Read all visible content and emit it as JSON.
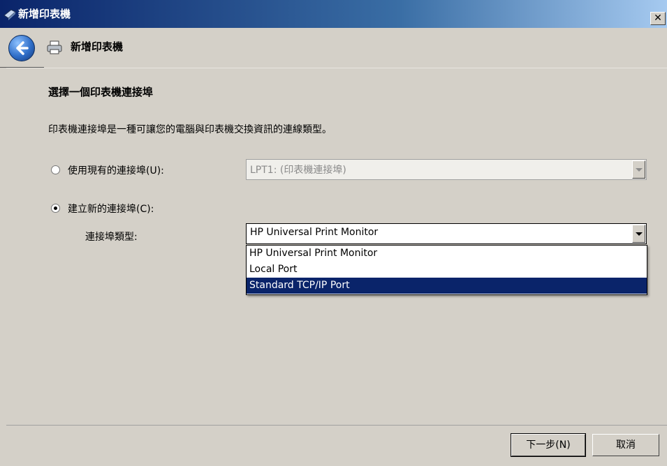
{
  "window": {
    "title": "新增印表機",
    "close_glyph": "✕"
  },
  "nav": {
    "title": "新增印表機",
    "back_icon": "back-arrow-icon",
    "printer_icon": "printer-icon"
  },
  "page": {
    "heading": "選擇一個印表機連接埠",
    "description": "印表機連接埠是一種可讓您的電腦與印表機交換資訊的連線類型。",
    "use_existing": {
      "label": "使用現有的連接埠(U):",
      "checked": false,
      "value": "LPT1: (印表機連接埠)",
      "disabled": true
    },
    "create_new": {
      "label": "建立新的連接埠(C):",
      "checked": true
    },
    "port_type": {
      "label": "連接埠類型:",
      "value": "HP Universal Print Monitor",
      "options": [
        "HP Universal Print Monitor",
        "Local Port",
        "Standard TCP/IP Port"
      ],
      "highlighted": "Standard TCP/IP Port"
    }
  },
  "buttons": {
    "next": "下一步(N)",
    "cancel": "取消"
  },
  "colors": {
    "selection": "#0a246a",
    "dialog_bg": "#d4d0c8"
  }
}
